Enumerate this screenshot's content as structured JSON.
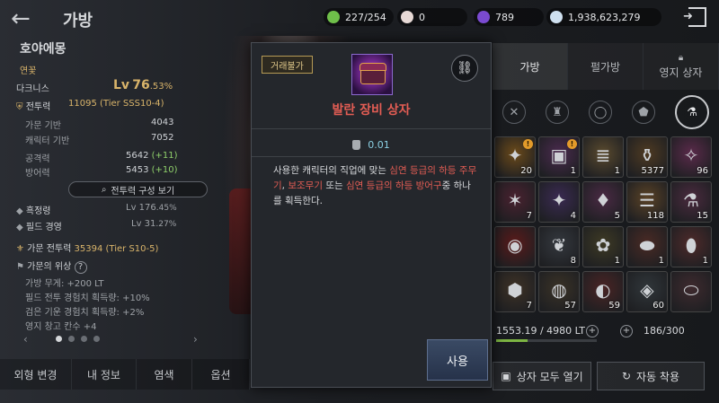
{
  "header": {
    "back_icon": "back-arrow-icon",
    "title": "가방",
    "resources": [
      {
        "icon": "energy-icon",
        "color": "#6fbf4a",
        "value": "227/254"
      },
      {
        "icon": "pearl-icon",
        "color": "#e7d9d6",
        "value": "0"
      },
      {
        "icon": "crystal-icon",
        "color": "#7a4ad0",
        "value": "789"
      },
      {
        "icon": "silver-icon",
        "color": "#cfe0ef",
        "value": "1,938,623,279"
      }
    ],
    "exit_icon": "exit-icon"
  },
  "character": {
    "name": "호야에몽",
    "family_label": "연꽃",
    "class": "다크니스",
    "level_prefix": "Lv",
    "level": "76",
    "level_pct": ".53%",
    "combat_label": "전투력",
    "combat_value": "11095 (Tier SSS10-4)",
    "family_base_label": "가문 기반",
    "family_base_value": "4043",
    "char_base_label": "캐릭터 기반",
    "char_base_value": "7052",
    "attack_label": "공격력",
    "attack_value": "5642",
    "attack_bonus": "(+11)",
    "defense_label": "방어력",
    "defense_value": "5453",
    "defense_bonus": "(+10)",
    "build_button": "전투력 구성 보기",
    "black_spirit_label": "흑정령",
    "black_spirit_level": "Lv 176",
    "black_spirit_pct": ".45%",
    "field_label": "필드 경영",
    "field_level": "Lv 31",
    "field_pct": ".27%",
    "family_combat_label": "가문 전투력",
    "family_combat_value": "35394 (Tier S10-5)",
    "prestige_label": "가문의 위상",
    "prestige_items": [
      "가방 무게: +200 LT",
      "필드 전투 경험치 획득량: +10%",
      "검은 기운 경험치 획득량: +2%",
      "영지 창고 칸수 +4"
    ]
  },
  "bottom_tabs": [
    "외형 변경",
    "내 정보",
    "염색",
    "옵션"
  ],
  "inventory": {
    "tabs": [
      "가방",
      "펄가방",
      "영지 상자"
    ],
    "active_tab": 0,
    "filter_icons": [
      "all-items-icon",
      "weapon-icon",
      "armor-icon",
      "accessory-icon",
      "crystal-icon",
      "potion-icon"
    ],
    "slots": [
      {
        "glyph": "✦",
        "bg": "#6b4a1a",
        "count": "20",
        "alert": true
      },
      {
        "glyph": "▣",
        "bg": "#4a2a4e",
        "count": "1",
        "alert": true
      },
      {
        "glyph": "≣",
        "bg": "#5a4a2e",
        "count": "1",
        "alert": false
      },
      {
        "glyph": "⚱",
        "bg": "#4e3a22",
        "count": "5377",
        "alert": false
      },
      {
        "glyph": "✧",
        "bg": "#5a2a4a",
        "count": "96",
        "alert": false
      },
      {
        "glyph": "✶",
        "bg": "#4a2230",
        "count": "7",
        "alert": false
      },
      {
        "glyph": "✦",
        "bg": "#3a2a52",
        "count": "4",
        "alert": false
      },
      {
        "glyph": "♦",
        "bg": "#4a2a44",
        "count": "5",
        "alert": false
      },
      {
        "glyph": "☰",
        "bg": "#5a4226",
        "count": "118",
        "alert": false
      },
      {
        "glyph": "⚗",
        "bg": "#4a2a3e",
        "count": "15",
        "alert": false
      },
      {
        "glyph": "◉",
        "bg": "#5a1a1a",
        "count": "",
        "alert": false
      },
      {
        "glyph": "❦",
        "bg": "#34383e",
        "count": "8",
        "alert": false
      },
      {
        "glyph": "✿",
        "bg": "#3e3a24",
        "count": "1",
        "alert": false
      },
      {
        "glyph": "⬬",
        "bg": "#4a2a24",
        "count": "1",
        "alert": false
      },
      {
        "glyph": "⬮",
        "bg": "#4e2a2a",
        "count": "1",
        "alert": false
      },
      {
        "glyph": "⬢",
        "bg": "#3e3226",
        "count": "7",
        "alert": false
      },
      {
        "glyph": "◍",
        "bg": "#3a3226",
        "count": "57",
        "alert": false
      },
      {
        "glyph": "◐",
        "bg": "#4a2424",
        "count": "59",
        "alert": false
      },
      {
        "glyph": "◈",
        "bg": "#30363a",
        "count": "60",
        "alert": false
      },
      {
        "glyph": "⬭",
        "bg": "#3e2a2e",
        "count": "",
        "alert": false
      }
    ],
    "weight": "1553.19 / 4980 LT",
    "weight_pct": 0.31,
    "slot_count": "186/300",
    "open_all_button": "상자 모두 열기",
    "auto_equip_button": "자동 착용"
  },
  "item_popup": {
    "trade_badge": "거래불가",
    "link_icon": "link-icon",
    "item_name": "발란 장비 상자",
    "weight": "0.01",
    "desc_1": "사용한 캐릭터의 직업에 맞는 ",
    "desc_hl_1": "심연 등급의 하등 주무기",
    "desc_2": ", ",
    "desc_hl_2": "보조무기",
    "desc_3": " 또는 ",
    "desc_hl_3": "심연 등급의 하등 방어구",
    "desc_4": "중 하나를 획득한다.",
    "use_button": "사용"
  }
}
